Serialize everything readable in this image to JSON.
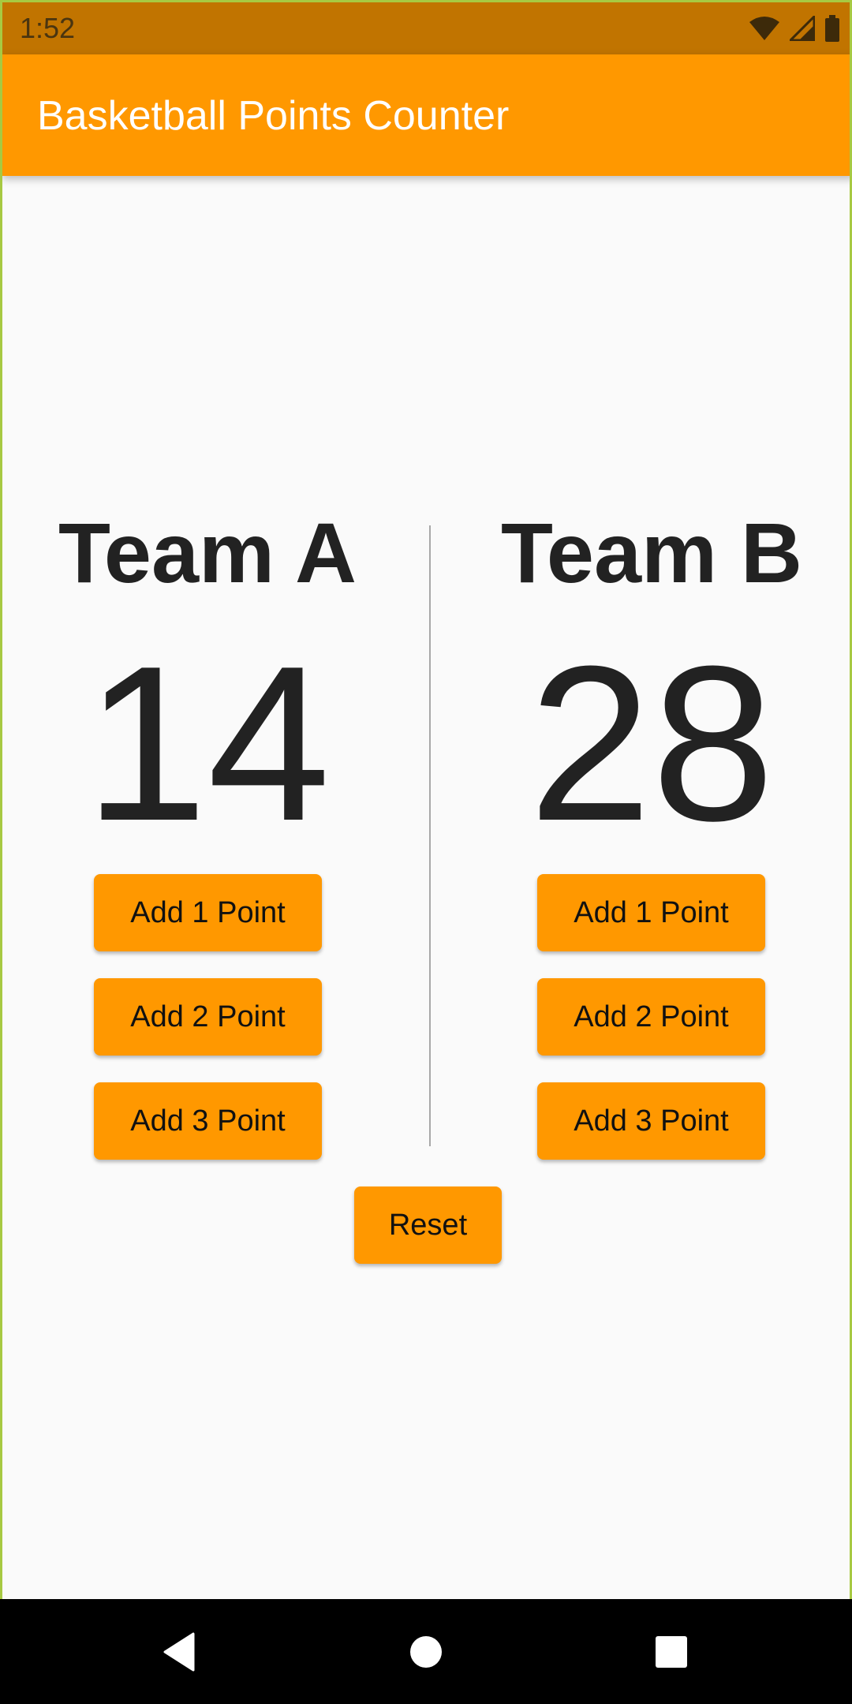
{
  "status_bar": {
    "time": "1:52",
    "icons": [
      "wifi-icon",
      "signal-icon",
      "battery-icon"
    ]
  },
  "app_bar": {
    "title": "Basketball Points Counter",
    "color": "#ff9800"
  },
  "team_a": {
    "name": "Team A",
    "score": "14",
    "buttons": [
      "Add 1 Point",
      "Add 2 Point",
      "Add 3 Point"
    ]
  },
  "team_b": {
    "name": "Team B",
    "score": "28",
    "buttons": [
      "Add 1 Point",
      "Add 2 Point",
      "Add 3 Point"
    ]
  },
  "reset_label": "Reset",
  "nav_bar": {
    "icons": [
      "back-icon",
      "home-icon",
      "recents-icon"
    ]
  },
  "colors": {
    "accent": "#ff9800",
    "status_bar": "#c17400",
    "text": "#222222"
  }
}
